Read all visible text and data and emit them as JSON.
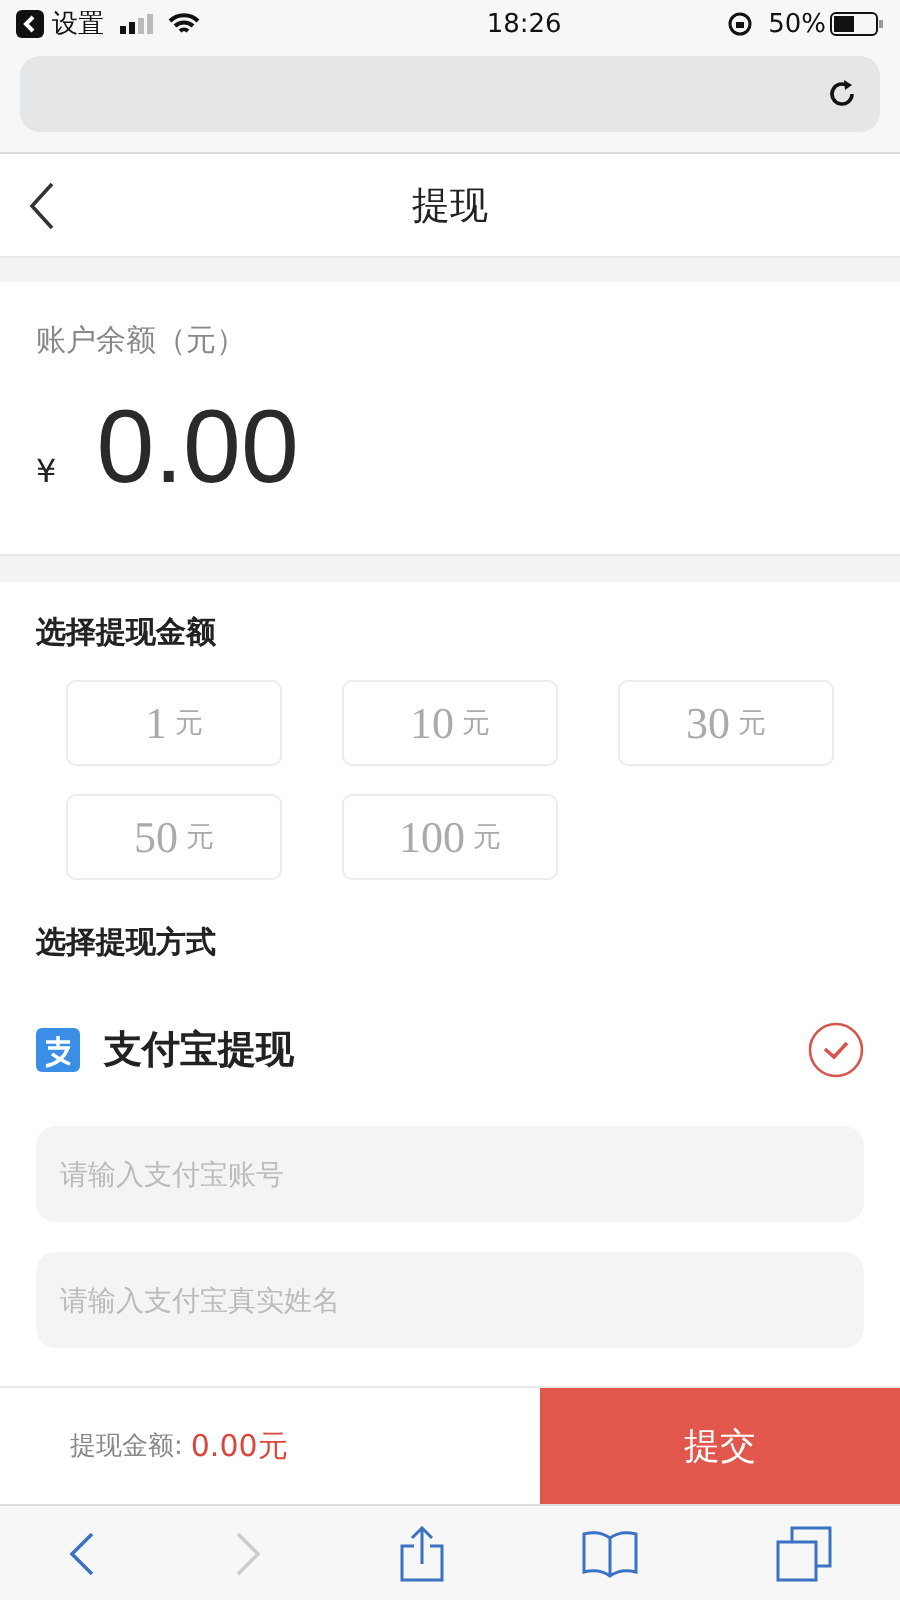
{
  "status_bar": {
    "back_app": "设置",
    "time": "18:26",
    "battery": "50%"
  },
  "header": {
    "title": "提现"
  },
  "balance": {
    "label": "账户余额（元）",
    "currency": "¥",
    "amount": "0.00"
  },
  "amount_section": {
    "title": "选择提现金额",
    "options": [
      {
        "amount": "1",
        "unit": "元",
        "selected": false
      },
      {
        "amount": "10",
        "unit": "元",
        "selected": false
      },
      {
        "amount": "30",
        "unit": "元",
        "selected": false
      },
      {
        "amount": "50",
        "unit": "元",
        "selected": false
      },
      {
        "amount": "100",
        "unit": "元",
        "selected": false
      }
    ]
  },
  "method_section": {
    "title": "选择提现方式",
    "methods": [
      {
        "label": "支付宝提现",
        "selected": true
      }
    ],
    "fields": [
      {
        "placeholder": "请输入支付宝账号"
      },
      {
        "placeholder": "请输入支付宝真实姓名"
      }
    ]
  },
  "footer": {
    "total_label": "提现金额:",
    "total_value": "0.00元",
    "submit": "提交"
  },
  "browser_toolbar": {
    "forward_disabled": true
  }
}
